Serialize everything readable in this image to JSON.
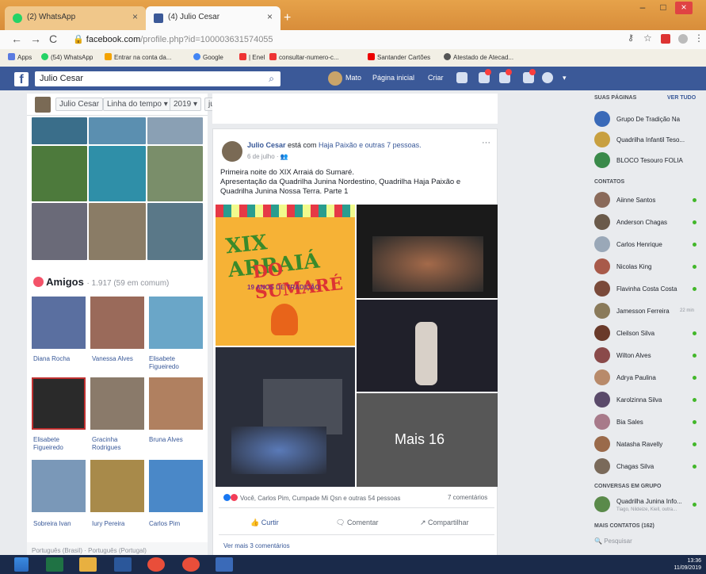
{
  "browser": {
    "tabs": [
      {
        "label": "(2) WhatsApp",
        "close": "×"
      },
      {
        "label": "(4) Julio Cesar",
        "close": "×"
      }
    ],
    "new_tab": "+",
    "window_buttons": [
      "–",
      "□",
      "×"
    ],
    "url_host": "facebook.com",
    "url_path": "/profile.php?id=100003631574055",
    "nav": {
      "back": "←",
      "forward": "→",
      "reload": "C"
    },
    "bookmarks": [
      "Apps",
      "(54) WhatsApp",
      "Entrar na conta da...",
      "Google",
      "| Enel",
      "consultar-numero-c...",
      "Santander Cartões",
      "Atestado de Atecad..."
    ]
  },
  "fb": {
    "search_value": "Julio Cesar",
    "user": "Mato",
    "nav": [
      "Página inicial",
      "Criar"
    ]
  },
  "timeline": {
    "name": "Julio Cesar",
    "section": "Linha do tempo ▾",
    "year": "2019 ▾",
    "month": "julho ▾"
  },
  "friends": {
    "title": "Amigos",
    "count": "· 1.917 (59 em comum)",
    "items": [
      {
        "name": "Diana Rocha"
      },
      {
        "name": "Vanessa Alves"
      },
      {
        "name": "Elisabete Figueiredo"
      },
      {
        "name": "Elisabete Figueiredo"
      },
      {
        "name": "Gracinha Rodrigues"
      },
      {
        "name": "Bruna Alves"
      },
      {
        "name": "Sobreira Ivan"
      },
      {
        "name": "Iury Pereira"
      },
      {
        "name": "Carlos Pim"
      }
    ]
  },
  "language": {
    "text": "Português (Brasil) · Português (Portugal)"
  },
  "post": {
    "author": "Julio Cesar",
    "with_text": " está com ",
    "tagged": "Haja Paixão e outras 7 pessoas.",
    "date": "6 de julho",
    "text_line1": "Primeira noite do XIX Arraiá do Sumaré.",
    "text_line2": "Apresentação da Quadrilha Junina Nordestino, Quadrilha Haja Paixão e Quadrilha Junina Nossa Terra. Parte 1",
    "banner_title1": "XIX ARRAIÁ",
    "banner_title2": "DO SUMARÉ",
    "banner_sub": "19 ANOS DE TRADIÇÃO",
    "more_photos": "Mais 16",
    "reactions": "Você, Carlos Pim, Cumpade Mi Qsn e outras 54 pessoas",
    "comments": "7 comentários",
    "actions": {
      "like": "Curtir",
      "comment": "Comentar",
      "share": "Compartilhar"
    },
    "more_comments": "Ver mais 3 comentários",
    "options": "···"
  },
  "sidebar": {
    "pages_header": "SUAS PÁGINAS",
    "see_all": "VER TUDO",
    "pages": [
      {
        "name": "Grupo De Tradição Na"
      },
      {
        "name": "Quadrilha Infantil Teso..."
      },
      {
        "name": "BLOCO Tesouro FOLIA"
      }
    ],
    "contacts_header": "CONTATOS",
    "contacts": [
      {
        "name": "Aiinne Santos"
      },
      {
        "name": "Anderson Chagas"
      },
      {
        "name": "Carlos Henrique"
      },
      {
        "name": "Nicolas King"
      },
      {
        "name": "Flavinha Costa Costa"
      },
      {
        "name": "Jamesson Ferreira",
        "time": "22 min"
      },
      {
        "name": "Cleilson Silva"
      },
      {
        "name": "Wilton Alves"
      },
      {
        "name": "Adrya Paulina"
      },
      {
        "name": "Karolzinna Silva"
      },
      {
        "name": "Bia Sales"
      },
      {
        "name": "Natasha Ravelly"
      },
      {
        "name": "Chagas Silva"
      }
    ],
    "groups_header": "CONVERSAS EM GRUPO",
    "group": {
      "name": "Quadrilha Junina Info...",
      "members": "Tiago, Nildeize, Kiell, outra..."
    },
    "more_contacts": "MAIS CONTATOS (162)",
    "search_placeholder": "Pesquisar"
  },
  "taskbar": {
    "time": "13:36",
    "date": "11/09/2019"
  },
  "colors": {
    "fb_blue": "#3b5998",
    "link": "#385898",
    "online": "#42b72a"
  }
}
